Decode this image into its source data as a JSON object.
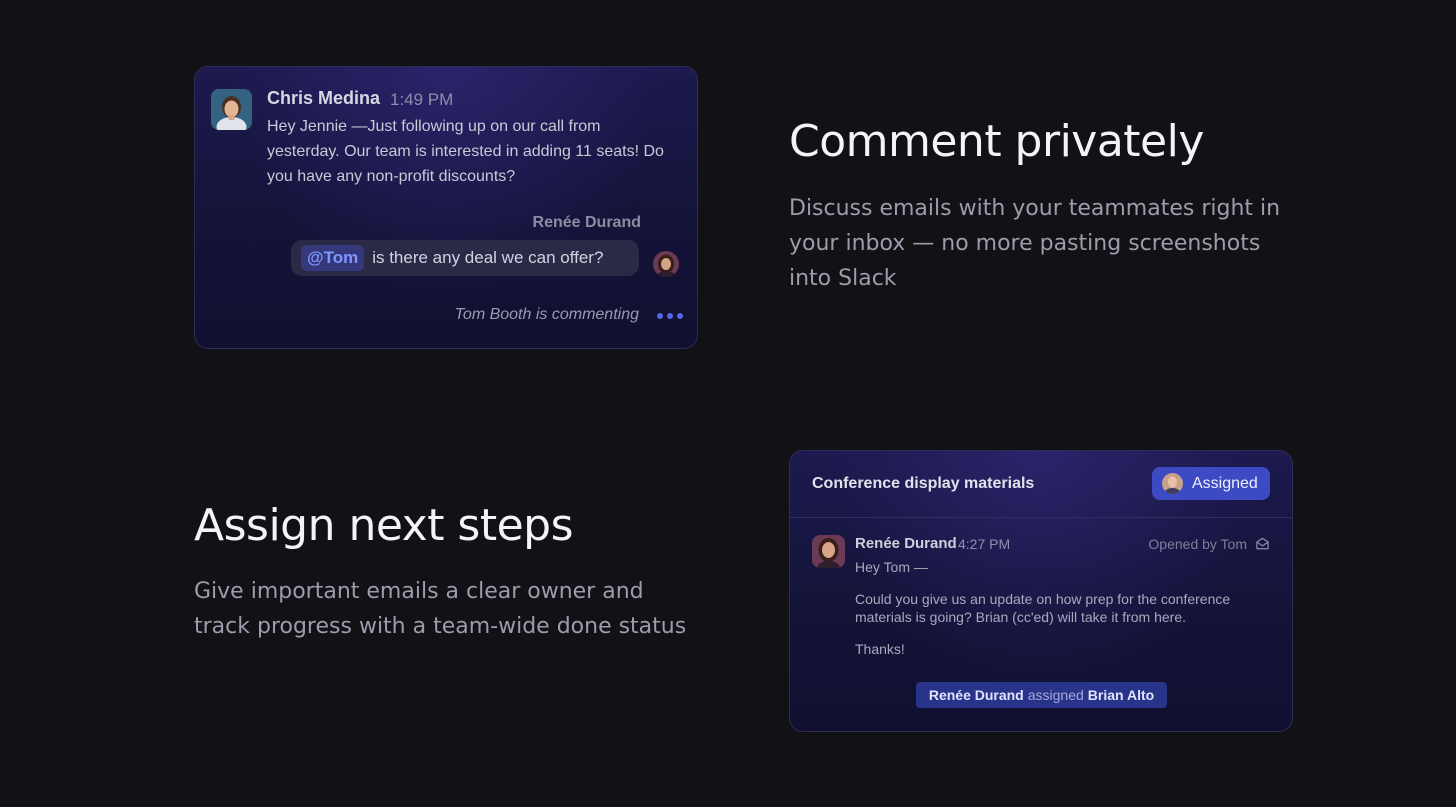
{
  "comment_card": {
    "sender_name": "Chris Medina",
    "sender_time": "1:49 PM",
    "message": "Hey Jennie —Just following up on our call from yesterday. Our team is interested in adding 11 seats! Do you have any non-profit discounts?",
    "commenter_name": "Renée Durand",
    "mention": "@Tom",
    "comment_text": "is there any deal we can offer?",
    "typing_status": "Tom Booth is commenting"
  },
  "feature_comment": {
    "title": "Comment privately",
    "description": "Discuss emails with your teammates right in your inbox — no more pasting screenshots into Slack"
  },
  "feature_assign": {
    "title": "Assign next steps",
    "description": "Give important emails a clear owner and track progress with a team-wide done status"
  },
  "assign_card": {
    "conversation_title": "Conference display materials",
    "status_badge": "Assigned",
    "sender_name": "Renée Durand",
    "sender_time": "4:27 PM",
    "opened_by": "Opened by Tom",
    "greeting": "Hey Tom —",
    "body": "Could you give us an update on how prep for the conference materials is going? Brian (cc'ed) will take it from here.",
    "signoff": "Thanks!",
    "assignment": {
      "assigner": "Renée Durand",
      "verb": "assigned",
      "assignee": "Brian Alto"
    }
  },
  "colors": {
    "background": "#111116",
    "accent": "#3c4ac4",
    "mention": "#7d97ff",
    "typing_dots": "#4f67e6"
  },
  "icons": {
    "typing": "ellipsis-icon",
    "opened": "envelope-open-icon"
  }
}
